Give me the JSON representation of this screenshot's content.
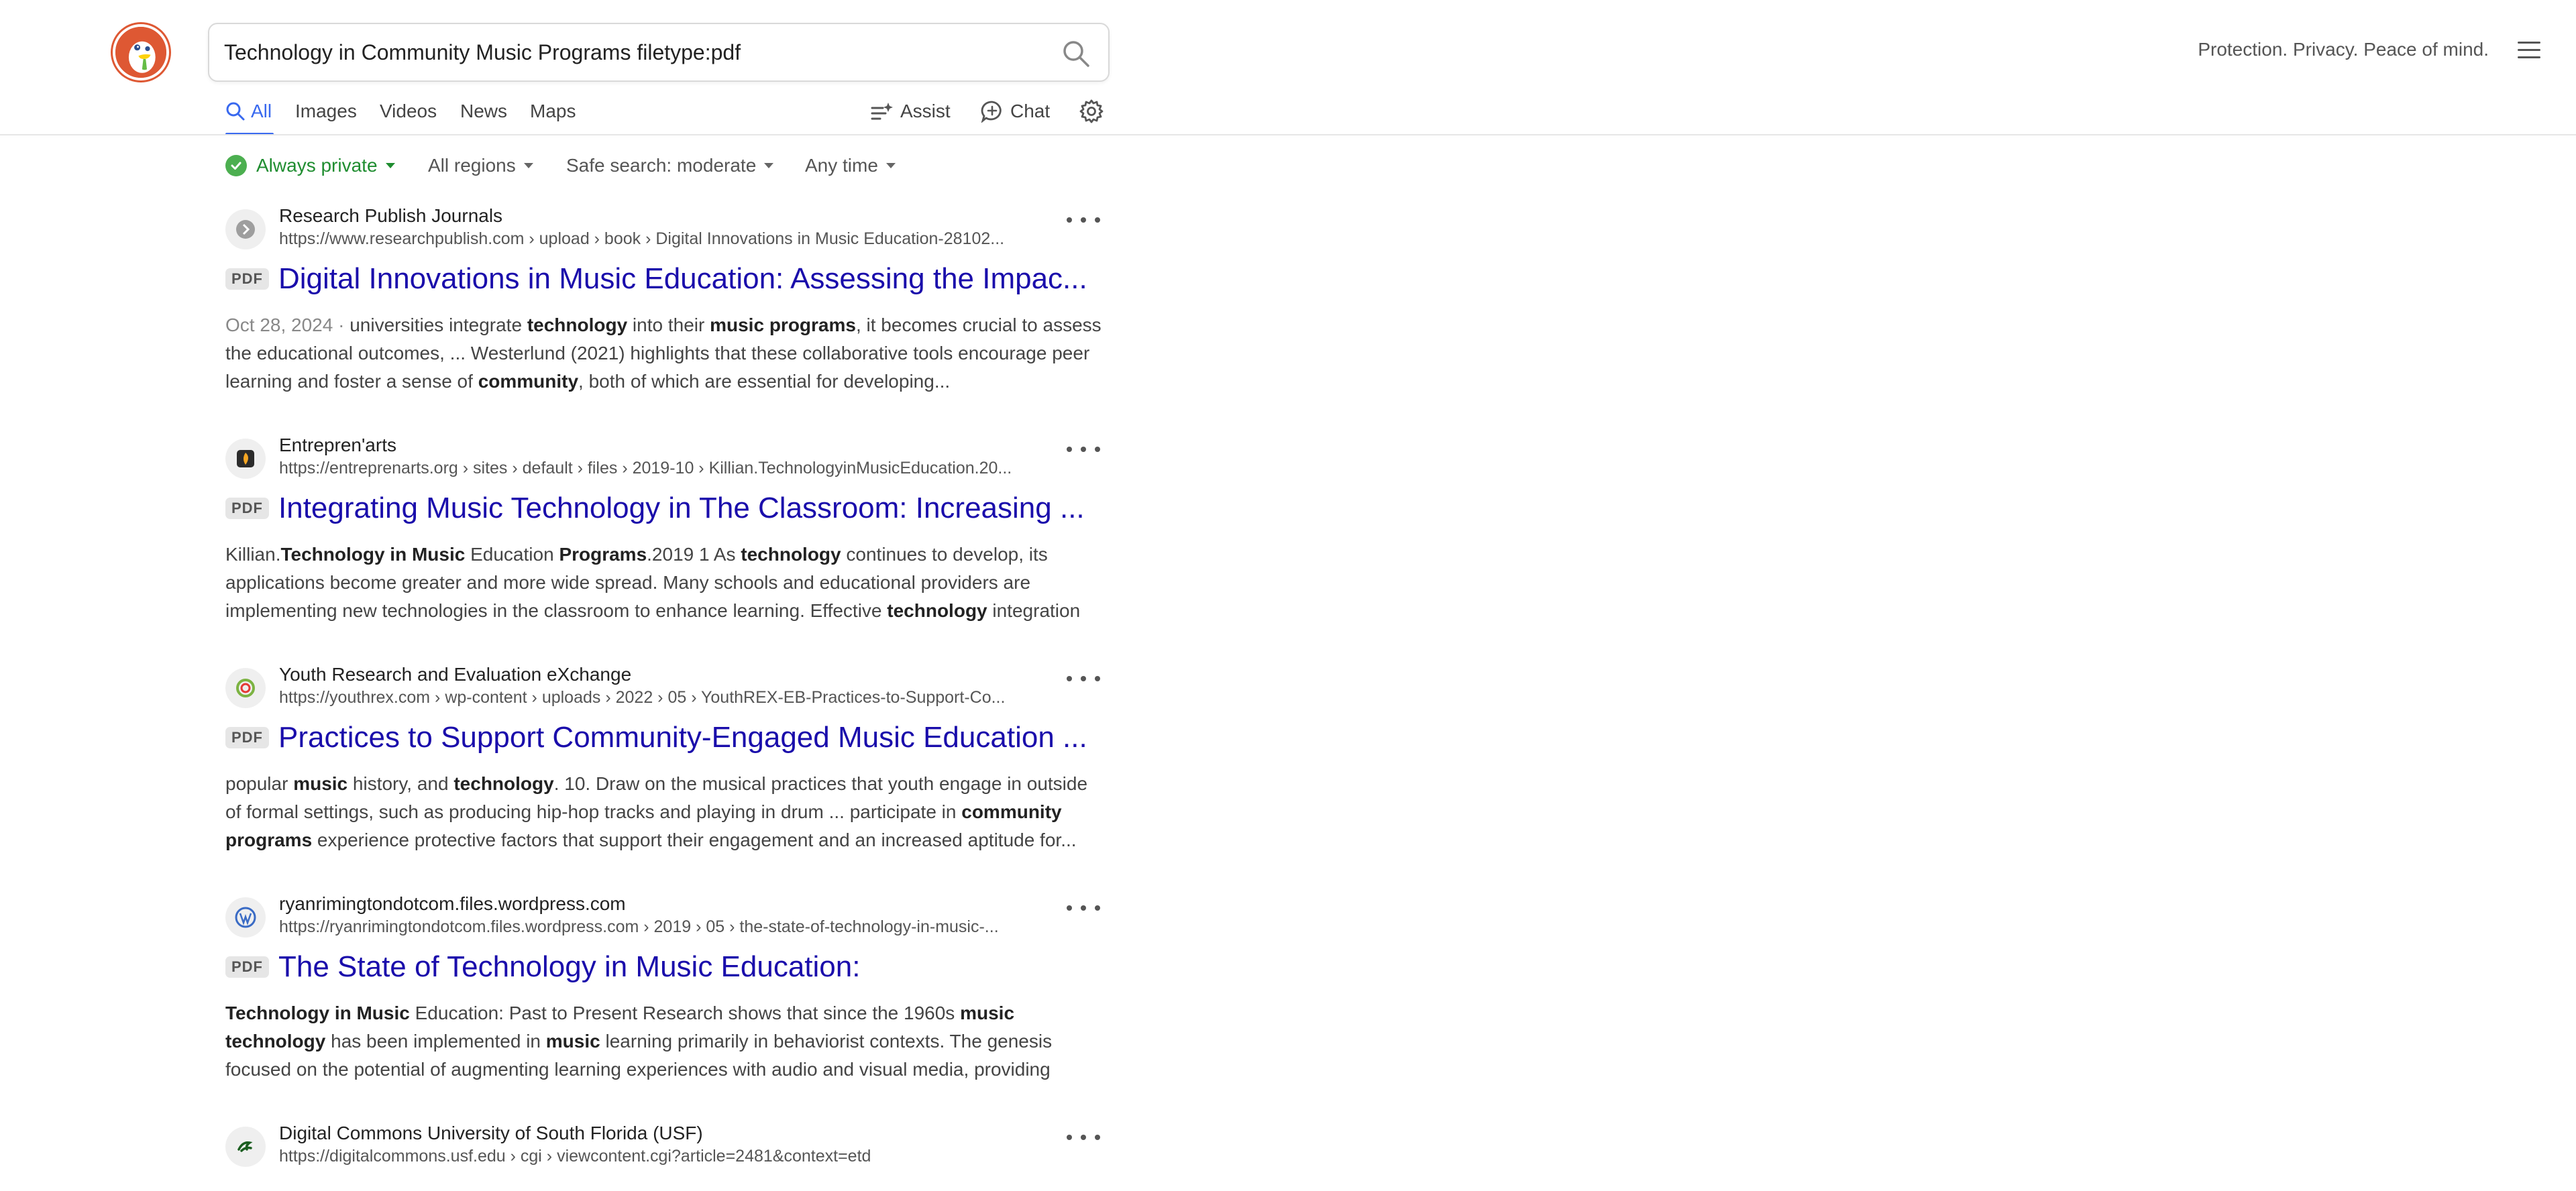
{
  "search": {
    "query": "Technology in Community Music Programs filetype:pdf"
  },
  "header": {
    "tagline": "Protection. Privacy. Peace of mind."
  },
  "nav": {
    "tabs": [
      "All",
      "Images",
      "Videos",
      "News",
      "Maps"
    ],
    "assist_label": "Assist",
    "chat_label": "Chat"
  },
  "filters": {
    "private": "Always private",
    "region": "All regions",
    "safe_search": "Safe search: moderate",
    "time": "Any time"
  },
  "results": [
    {
      "site": "Research Publish Journals",
      "url": "https://www.researchpublish.com › upload › book › Digital Innovations in Music Education-28102...",
      "badge": "PDF",
      "title": "Digital Innovations in Music Education: Assessing the Impac...",
      "date": "Oct 28, 2024",
      "snippet": [
        {
          "t": "universities integrate ",
          "b": false
        },
        {
          "t": "technology",
          "b": true
        },
        {
          "t": " into their ",
          "b": false
        },
        {
          "t": "music programs",
          "b": true
        },
        {
          "t": ", it becomes crucial to assess the educational outcomes, ... Westerlund (2021) highlights that these collaborative tools encourage peer learning and foster a sense of ",
          "b": false
        },
        {
          "t": "community",
          "b": true
        },
        {
          "t": ", both of which are essential for developing...",
          "b": false
        }
      ]
    },
    {
      "site": "Entrepren'arts",
      "url": "https://entreprenarts.org › sites › default › files › 2019-10 › Killian.TechnologyinMusicEducation.20...",
      "badge": "PDF",
      "title": "Integrating Music Technology in The Classroom: Increasing ...",
      "date": "",
      "snippet": [
        {
          "t": "Killian.",
          "b": false
        },
        {
          "t": "Technology in Music",
          "b": true
        },
        {
          "t": " Education ",
          "b": false
        },
        {
          "t": "Programs",
          "b": true
        },
        {
          "t": ".2019 1 As ",
          "b": false
        },
        {
          "t": "technology",
          "b": true
        },
        {
          "t": " continues to develop, its applications become greater and more wide spread. Many schools and educational providers are implementing new technologies in the classroom to enhance learning. Effective ",
          "b": false
        },
        {
          "t": "technology",
          "b": true
        },
        {
          "t": " integration",
          "b": false
        }
      ]
    },
    {
      "site": "Youth Research and Evaluation eXchange",
      "url": "https://youthrex.com › wp-content › uploads › 2022 › 05 › YouthREX-EB-Practices-to-Support-Co...",
      "badge": "PDF",
      "title": "Practices to Support Community-Engaged Music Education ...",
      "date": "",
      "snippet": [
        {
          "t": "popular ",
          "b": false
        },
        {
          "t": "music",
          "b": true
        },
        {
          "t": " history, and ",
          "b": false
        },
        {
          "t": "technology",
          "b": true
        },
        {
          "t": ". 10. Draw on the musical practices that youth engage in outside of formal settings, such as producing hip-hop tracks and playing in drum ... participate in ",
          "b": false
        },
        {
          "t": "community programs",
          "b": true
        },
        {
          "t": " experience protective factors that support their engagement and an increased aptitude for...",
          "b": false
        }
      ]
    },
    {
      "site": "ryanrimingtondotcom.files.wordpress.com",
      "url": "https://ryanrimingtondotcom.files.wordpress.com › 2019 › 05 › the-state-of-technology-in-music-...",
      "badge": "PDF",
      "title": "The State of Technology in Music Education:",
      "date": "",
      "snippet": [
        {
          "t": "Technology in Music",
          "b": true
        },
        {
          "t": " Education: Past to Present Research shows that since the 1960s ",
          "b": false
        },
        {
          "t": "music technology",
          "b": true
        },
        {
          "t": " has been implemented in ",
          "b": false
        },
        {
          "t": "music",
          "b": true
        },
        {
          "t": " learning primarily in behaviorist contexts. The genesis focused on the potential of augmenting learning experiences with audio and visual media, providing individualized...",
          "b": false
        }
      ]
    },
    {
      "site": "Digital Commons University of South Florida (USF)",
      "url": "https://digitalcommons.usf.edu › cgi › viewcontent.cgi?article=2481&context=etd",
      "badge": "",
      "title": "",
      "date": "",
      "snippet": []
    }
  ],
  "colors": {
    "accent": "#3969ef",
    "link": "#1a0dab",
    "private_green": "#1f8d30",
    "logo": "#de5833"
  },
  "icons": {
    "search": "magnifier-icon",
    "menu": "hamburger-icon",
    "settings": "gear-icon"
  }
}
